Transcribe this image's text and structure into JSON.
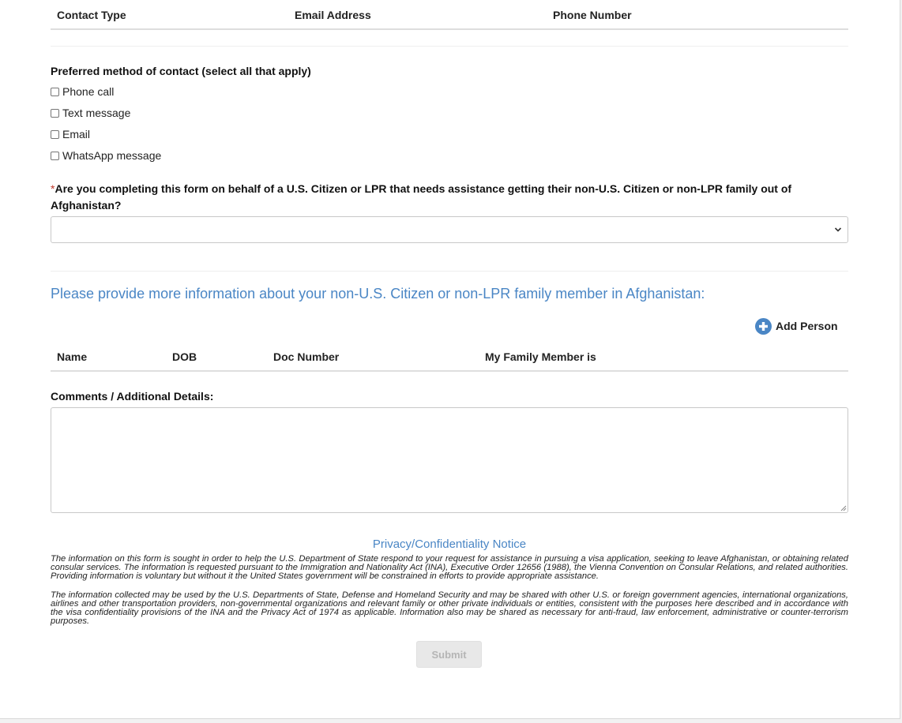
{
  "contact_table": {
    "headers": [
      "Contact Type",
      "Email Address",
      "Phone Number"
    ]
  },
  "preferred_contact": {
    "label": "Preferred method of contact (select all that apply)",
    "options": [
      "Phone call",
      "Text message",
      "Email",
      "WhatsApp message"
    ]
  },
  "behalf_question": {
    "required_mark": "*",
    "label": "Are you completing this form on behalf of a U.S. Citizen or LPR that needs assistance getting their non-U.S. Citizen or non-LPR family out of Afghanistan?",
    "selected_value": ""
  },
  "family_section": {
    "title": "Please provide more information about your non-U.S. Citizen or non-LPR family member in Afghanistan:",
    "add_person_label": "Add Person",
    "headers": [
      "Name",
      "DOB",
      "Doc Number",
      "My Family Member is"
    ]
  },
  "comments": {
    "label": "Comments / Additional Details:",
    "value": ""
  },
  "privacy": {
    "title": "Privacy/Confidentiality Notice",
    "paragraph1": "The information on this form is sought in order to help the U.S. Department of State respond to your request for assistance in pursuing a visa application, seeking to leave Afghanistan, or obtaining related consular services. The information is requested pursuant to the Immigration and Nationality Act (INA), Executive Order 12656 (1988), the Vienna Convention on Consular Relations, and related authorities. Providing information is voluntary but without it the United States government will be constrained in efforts to provide appropriate assistance.",
    "paragraph2": "The information collected may be used by the U.S. Departments of State, Defense and Homeland Security and may be shared with other U.S. or foreign government agencies, international organizations, airlines and other transportation providers, non-governmental organizations and relevant family or other private individuals or entities, consistent with the purposes here described and in accordance with the visa confidentiality provisions of the INA and the Privacy Act of 1974 as applicable. Information also may be shared as necessary for anti-fraud, law enforcement, administrative or counter-terrorism purposes."
  },
  "submit_label": "Submit",
  "colors": {
    "accent_blue": "#4a86c5",
    "required_red": "#c0392b",
    "disabled_text": "#b5b5b5"
  }
}
